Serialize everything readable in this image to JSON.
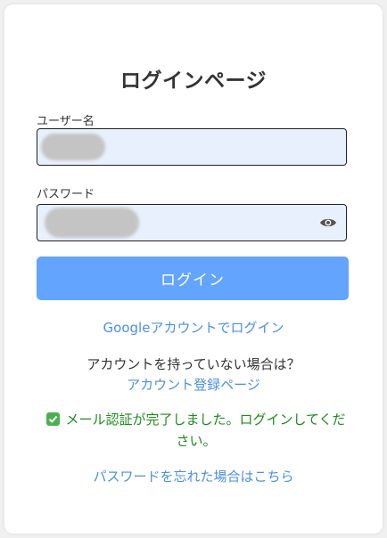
{
  "page": {
    "title": "ログインページ"
  },
  "form": {
    "username_label": "ユーザー名",
    "username_value": "",
    "password_label": "パスワード",
    "password_value": "",
    "login_button": "ログイン"
  },
  "links": {
    "google_login": "Googleアカウントでログイン",
    "no_account_prompt": "アカウントを持っていない場合は？",
    "register": "アカウント登録ページ",
    "forgot_password": "パスワードを忘れた場合はこちら"
  },
  "messages": {
    "email_verified": "メール認証が完了しました。ログインしてください。"
  },
  "icons": {
    "password_toggle": "eye-icon",
    "success": "check-mark-icon"
  },
  "colors": {
    "primary_button": "#63a4ff",
    "link": "#4a90e2",
    "success_text": "#1e8a1e",
    "field_background": "#e8f0fe"
  }
}
